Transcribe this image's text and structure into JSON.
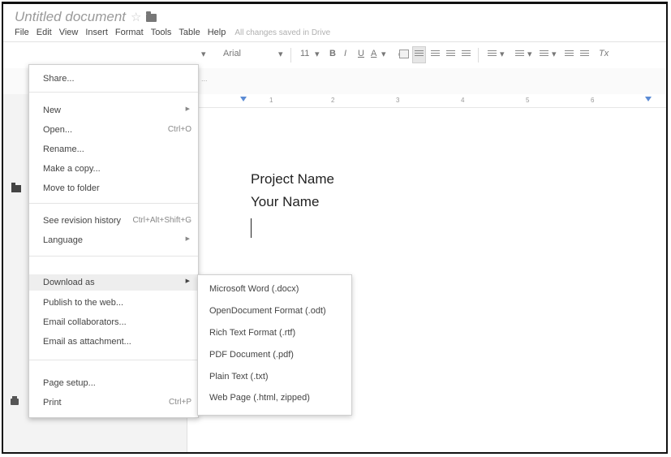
{
  "document": {
    "title": "Untitled document",
    "save_status": "All changes saved in Drive",
    "body_lines": [
      "Project Name",
      "Your Name"
    ]
  },
  "menubar": [
    "File",
    "Edit",
    "View",
    "Insert",
    "Format",
    "Tools",
    "Table",
    "Help"
  ],
  "toolbar": {
    "font": "Arial",
    "size": "11",
    "bold": "B",
    "italic": "I",
    "underline": "U",
    "text_color": "A",
    "clear_format": "Tx"
  },
  "file_menu": {
    "share": "Share...",
    "new": "New",
    "open": "Open...",
    "open_shortcut": "Ctrl+O",
    "rename": "Rename...",
    "make_copy": "Make a copy...",
    "move_to_folder": "Move to folder",
    "revision_history": "See revision history",
    "revision_shortcut": "Ctrl+Alt+Shift+G",
    "language": "Language",
    "download_as": "Download as",
    "publish": "Publish to the web...",
    "email_collaborators": "Email collaborators...",
    "email_attachment": "Email as attachment...",
    "page_setup": "Page setup...",
    "print": "Print",
    "print_shortcut": "Ctrl+P"
  },
  "download_submenu": [
    "Microsoft Word (.docx)",
    "OpenDocument Format (.odt)",
    "Rich Text Format (.rtf)",
    "PDF Document (.pdf)",
    "Plain Text (.txt)",
    "Web Page (.html, zipped)"
  ],
  "ruler_numbers": [
    "1",
    "2",
    "3",
    "4",
    "5",
    "6"
  ],
  "colors": {
    "highlight": "#eeeeee",
    "ruler_marker": "#5b8bd4"
  }
}
